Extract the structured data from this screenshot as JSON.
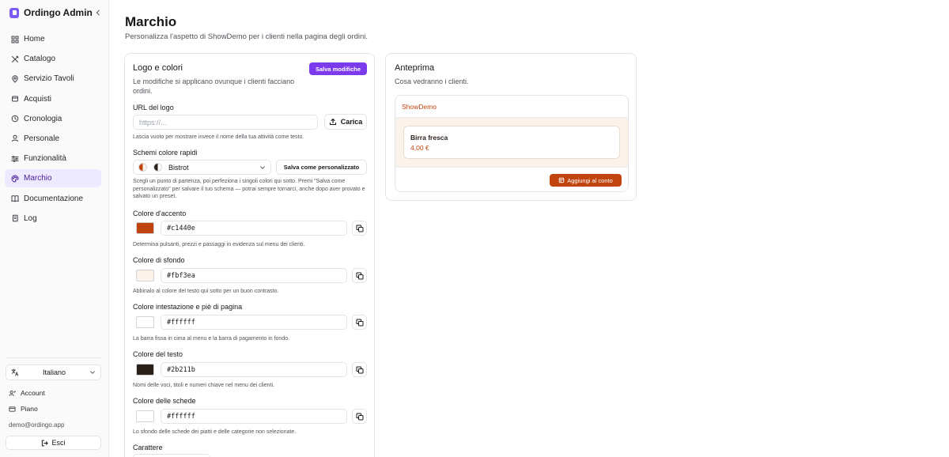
{
  "app": {
    "name": "Ordingo Admin"
  },
  "sidebar": {
    "items": [
      {
        "label": "Home",
        "icon": "grid-icon"
      },
      {
        "label": "Catalogo",
        "icon": "utensils-icon"
      },
      {
        "label": "Servizio Tavoli",
        "icon": "map-pin-icon"
      },
      {
        "label": "Acquisti",
        "icon": "receipt-icon"
      },
      {
        "label": "Cronologia",
        "icon": "history-icon"
      },
      {
        "label": "Personale",
        "icon": "user-icon"
      },
      {
        "label": "Funzionalità",
        "icon": "sliders-icon"
      },
      {
        "label": "Marchio",
        "icon": "palette-icon",
        "active": true
      },
      {
        "label": "Documentazione",
        "icon": "book-icon"
      },
      {
        "label": "Log",
        "icon": "scroll-icon"
      }
    ],
    "language": "Italiano",
    "account_label": "Account",
    "plan_label": "Piano",
    "email": "demo@ordingo.app",
    "logout_label": "Esci"
  },
  "page": {
    "title": "Marchio",
    "subtitle": "Personalizza l'aspetto di ShowDemo per i clienti nella pagina degli ordini."
  },
  "branding": {
    "title": "Logo e colori",
    "description": "Le modifiche si applicano ovunque i clienti facciano ordini.",
    "save_label": "Salva modifiche",
    "logo": {
      "label": "URL del logo",
      "placeholder": "https://...",
      "upload_label": "Carica",
      "hint": "Lascia vuoto per mostrare invece il nome della tua attività come testo."
    },
    "presets": {
      "label": "Schemi colore rapidi",
      "selected": "Bistrot",
      "save_custom_label": "Salva come personalizzato",
      "hint": "Scegli un punto di partenza, poi perfeziona i singoli colori qui sotto. Premi \"Salva come personalizzato\" per salvare il tuo schema — potrai sempre tornarci, anche dopo aver provato e salvato un preset."
    },
    "colors": [
      {
        "label": "Colore d'accento",
        "value": "#c1440e",
        "hint": "Determina pulsanti, prezzi e passaggi in evidenza sul menu dei clienti."
      },
      {
        "label": "Colore di sfondo",
        "value": "#fbf3ea",
        "hint": "Abbinalo al colore del testo qui sotto per un buon contrasto."
      },
      {
        "label": "Colore intestazione e piè di pagina",
        "value": "#ffffff",
        "hint": "La barra fissa in cima al menu e la barra di pagamento in fondo."
      },
      {
        "label": "Colore del testo",
        "value": "#2b211b",
        "hint": "Nomi delle voci, titoli e numeri chiave nel menu dei clienti."
      },
      {
        "label": "Colore delle schede",
        "value": "#ffffff",
        "hint": "Lo sfondo delle schede dei piatti e delle categorie non selezionate."
      }
    ],
    "font_label": "Carattere"
  },
  "preview": {
    "title": "Anteprima",
    "subtitle": "Cosa vedranno i clienti.",
    "brand_name": "ShowDemo",
    "item_name": "Birra fresca",
    "item_price": "4,00 €",
    "add_label": "Aggiungi al conto"
  }
}
